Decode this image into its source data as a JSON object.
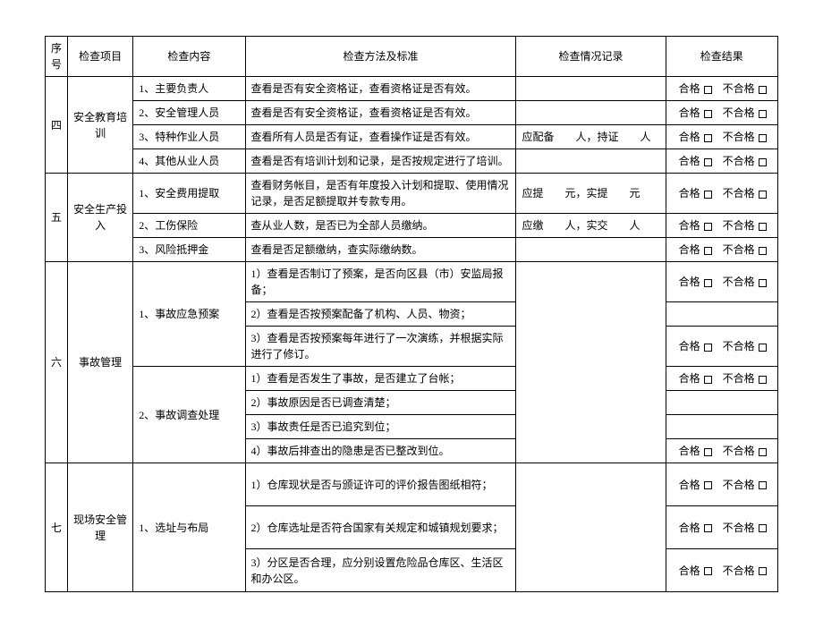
{
  "headers": {
    "seq": "序号",
    "item": "检查项目",
    "content": "检查内容",
    "method": "检查方法及标准",
    "record": "检查情况记录",
    "result": "检查结果"
  },
  "result_labels": {
    "pass": "合格",
    "fail": "不合格"
  },
  "sections": {
    "s4": {
      "seq": "四",
      "item": "安全教育培训",
      "rows": [
        {
          "content": "1、主要负责人",
          "method": "查看是否有安全资格证，查看资格证是否有效。",
          "record": ""
        },
        {
          "content": "2、安全管理人员",
          "method": "查看是否有安全资格证，查看资格证是否有效。",
          "record": ""
        },
        {
          "content": "3、特种作业人员",
          "method": "查看所有人员是否有证，查看操作证是否有效。",
          "record": "应配备　　人，持证　　人"
        },
        {
          "content": "4、其他从业人员",
          "method": "查看是否有培训计划和记录，是否按规定进行了培训。",
          "record": ""
        }
      ]
    },
    "s5": {
      "seq": "五",
      "item": "安全生产投入",
      "rows": [
        {
          "content": "1、安全费用提取",
          "method": "查看财务帐目，是否有年度投入计划和提取、使用情况记录，是否足额提取并专款专用。",
          "record": "应提　　元，实提　　元"
        },
        {
          "content": "2、工伤保险",
          "method": "查从业人数，是否已为全部人员缴纳。",
          "record": "应缴　　人，实交　　人"
        },
        {
          "content": "3、风险抵押金",
          "method": "查看是否足额缴纳，查实际缴纳数。",
          "record": ""
        }
      ]
    },
    "s6": {
      "seq": "六",
      "item": "事故管理",
      "rows": [
        {
          "content": "1、事故应急预案",
          "method_a": "1）查看是否制订了预案，是否向区县（市）安监局报备；",
          "method_b": "2）查看是否按预案配备了机构、人员、物资；",
          "method_c": "3）查看是否按预案每年进行了一次演练，并根据实际进行了修订。"
        },
        {
          "content": "2、事故调查处理",
          "method_a": "1）查看是否发生了事故，是否建立了台帐；",
          "method_b": "2）事故原因是否已调查清楚；",
          "method_c": "3）事故责任是否已追究到位；",
          "method_d": "4）事故后排查出的隐患是否已整改到位。"
        }
      ]
    },
    "s7": {
      "seq": "七",
      "item": "现场安全管理",
      "content": "1、选址与布局",
      "rows": [
        {
          "method": "1）仓库现状是否与颁证许可的评价报告图纸相符；"
        },
        {
          "method": "2）仓库选址是否符合国家有关规定和城镇规划要求；"
        },
        {
          "method": "3）分区是否合理，应分别设置危险品仓库区、生活区和办公区。"
        }
      ]
    }
  }
}
